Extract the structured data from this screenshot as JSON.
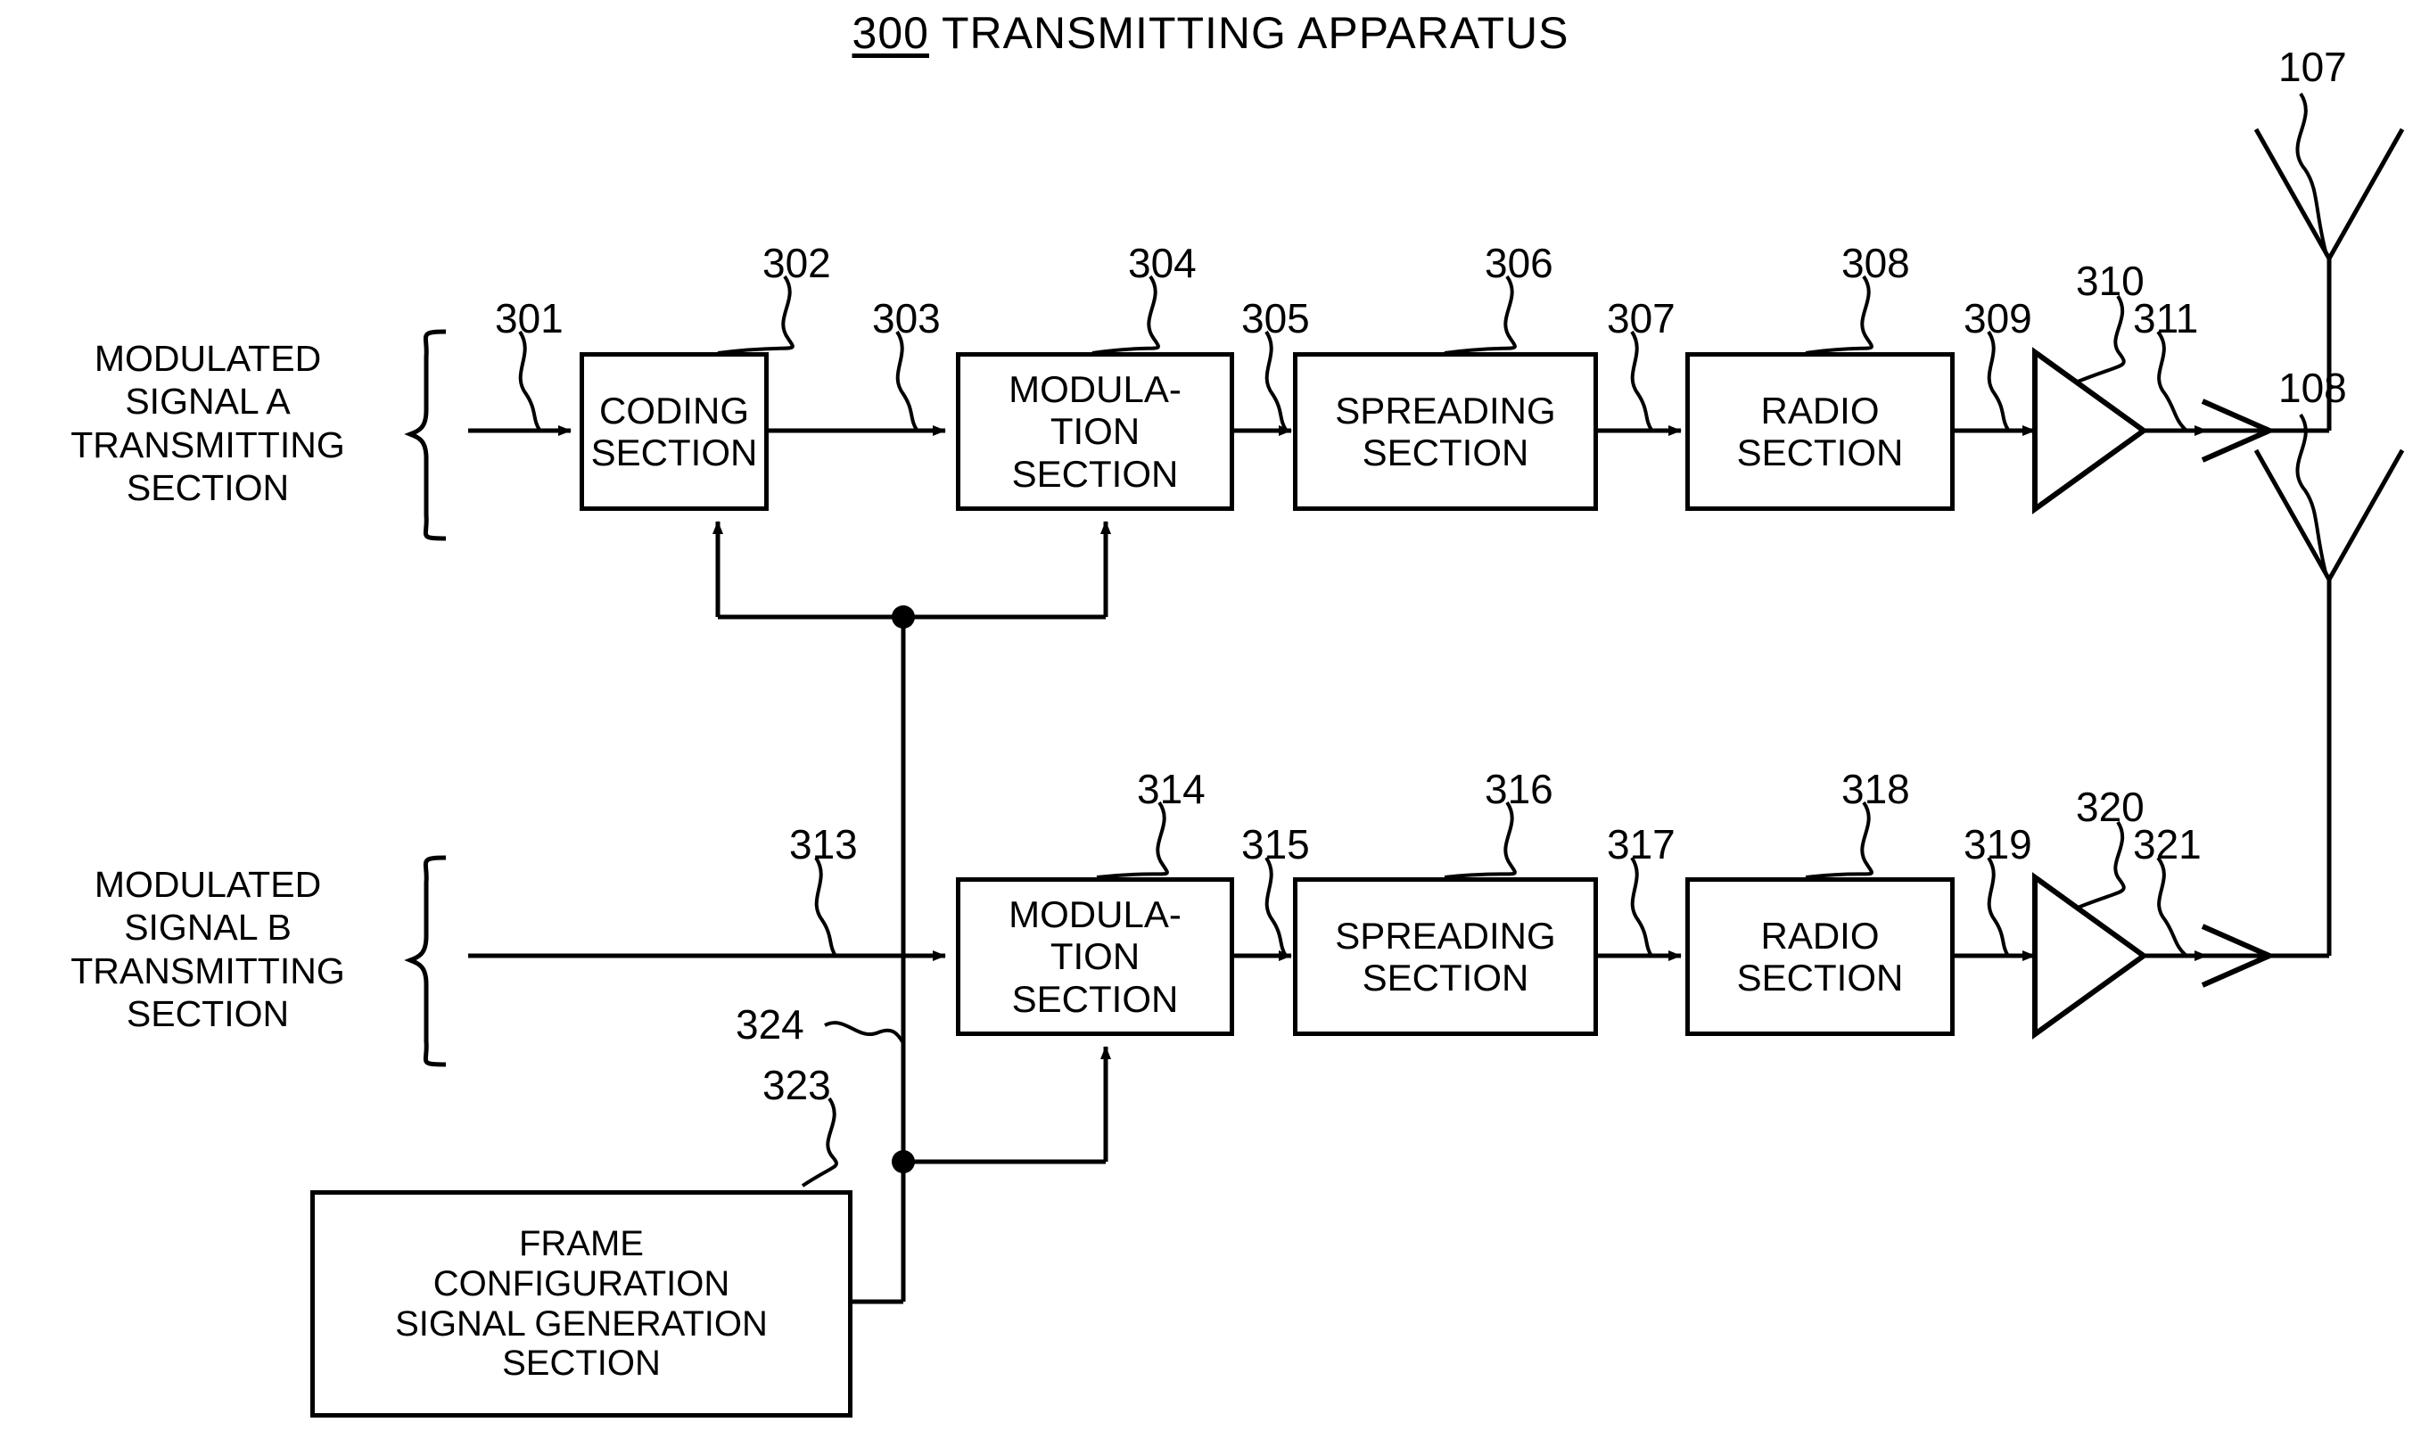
{
  "figure": {
    "title_ref": "300",
    "title_text": " TRANSMITTING APPARATUS"
  },
  "side_labels": [
    {
      "id": "modulated-signal-a-transmitting-section",
      "text": "MODULATED\nSIGNAL A\nTRANSMITTING\nSECTION"
    },
    {
      "id": "modulated-signal-b-transmitting-section",
      "text": "MODULATED\nSIGNAL B\nTRANSMITTING\nSECTION"
    }
  ],
  "blocks": [
    {
      "id": "coding-section-302",
      "label": "CODING\nSECTION",
      "ref": "302"
    },
    {
      "id": "modulation-section-304",
      "label": "MODULA-\nTION\nSECTION",
      "ref": "304"
    },
    {
      "id": "spreading-section-306",
      "label": "SPREADING\nSECTION",
      "ref": "306"
    },
    {
      "id": "radio-section-308",
      "label": "RADIO\nSECTION",
      "ref": "308"
    },
    {
      "id": "modulation-section-314",
      "label": "MODULA-\nTION\nSECTION",
      "ref": "314"
    },
    {
      "id": "spreading-section-316",
      "label": "SPREADING\nSECTION",
      "ref": "316"
    },
    {
      "id": "radio-section-318",
      "label": "RADIO\nSECTION",
      "ref": "318"
    },
    {
      "id": "frame-configuration-signal-generation-section-323",
      "label": "FRAME\nCONFIGURATION\nSIGNAL GENERATION\nSECTION",
      "ref": "323"
    }
  ],
  "reference_numerals": {
    "n107": "107",
    "n108": "108",
    "n301": "301",
    "n302": "302",
    "n303": "303",
    "n304": "304",
    "n305": "305",
    "n306": "306",
    "n307": "307",
    "n308": "308",
    "n309": "309",
    "n310": "310",
    "n311": "311",
    "n313": "313",
    "n314": "314",
    "n315": "315",
    "n316": "316",
    "n317": "317",
    "n318": "318",
    "n319": "319",
    "n320": "320",
    "n321": "321",
    "n323": "323",
    "n324": "324"
  },
  "symbols": {
    "amplifier_a": "amplifier-310",
    "amplifier_b": "amplifier-320",
    "antenna_a": "antenna-107",
    "antenna_b": "antenna-108"
  },
  "colors": {
    "ink": "#000000",
    "paper": "#ffffff"
  }
}
